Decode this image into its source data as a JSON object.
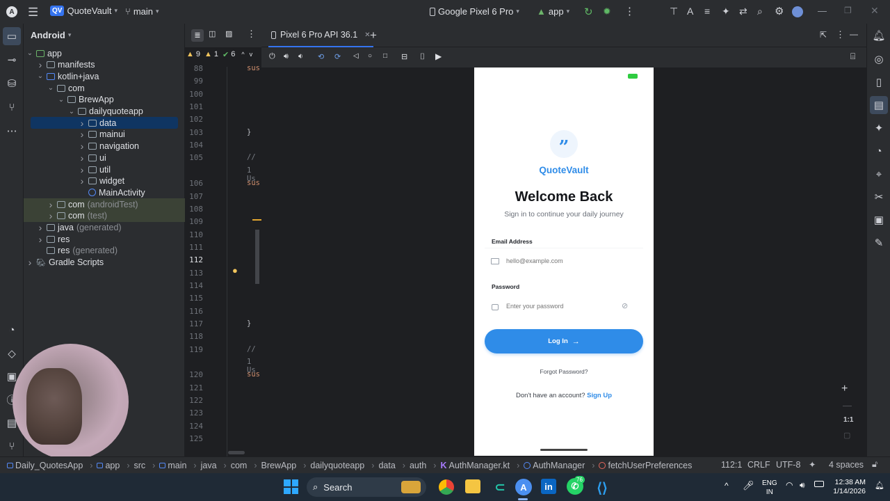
{
  "titlebar": {
    "project_badge": "QV",
    "project_name": "QuoteVault",
    "branch": "main",
    "device": "Google Pixel 6 Pro",
    "run_config": "app"
  },
  "project_panel": {
    "view_mode": "Android",
    "tree": [
      {
        "label": "app",
        "depth": 0,
        "expanded": true,
        "kind": "module"
      },
      {
        "label": "manifests",
        "depth": 1,
        "expanded": false,
        "kind": "folder"
      },
      {
        "label": "kotlin+java",
        "depth": 1,
        "expanded": true,
        "kind": "folder-blue"
      },
      {
        "label": "com",
        "depth": 2,
        "expanded": true,
        "kind": "package"
      },
      {
        "label": "BrewApp",
        "depth": 3,
        "expanded": true,
        "kind": "package"
      },
      {
        "label": "dailyquoteapp",
        "depth": 4,
        "expanded": true,
        "kind": "package"
      },
      {
        "label": "data",
        "depth": 5,
        "expanded": false,
        "kind": "package",
        "selected": true
      },
      {
        "label": "mainui",
        "depth": 5,
        "expanded": false,
        "kind": "package"
      },
      {
        "label": "navigation",
        "depth": 5,
        "expanded": false,
        "kind": "package"
      },
      {
        "label": "ui",
        "depth": 5,
        "expanded": false,
        "kind": "package"
      },
      {
        "label": "util",
        "depth": 5,
        "expanded": false,
        "kind": "package"
      },
      {
        "label": "widget",
        "depth": 5,
        "expanded": false,
        "kind": "package"
      },
      {
        "label": "MainActivity",
        "depth": 5,
        "expanded": null,
        "kind": "class"
      },
      {
        "label": "com",
        "suffix": "(androidTest)",
        "depth": 2,
        "expanded": false,
        "kind": "package",
        "tinted": true
      },
      {
        "label": "com",
        "suffix": "(test)",
        "depth": 2,
        "expanded": false,
        "kind": "package",
        "tinted": true
      },
      {
        "label": "java",
        "suffix": "(generated)",
        "depth": 1,
        "expanded": false,
        "kind": "folder"
      },
      {
        "label": "res",
        "depth": 1,
        "expanded": false,
        "kind": "folder"
      },
      {
        "label": "res",
        "suffix": "(generated)",
        "depth": 1,
        "expanded": null,
        "kind": "folder"
      },
      {
        "label": "Gradle Scripts",
        "depth": 0,
        "expanded": false,
        "kind": "gradle"
      }
    ]
  },
  "editor": {
    "warnings": "9",
    "errors": "1",
    "checks": "6",
    "line_numbers": [
      "88",
      "99",
      "100",
      "101",
      "102",
      "103",
      "104",
      "105",
      "",
      "106",
      "107",
      "108",
      "109",
      "110",
      "111",
      "112",
      "113",
      "114",
      "115",
      "116",
      "117",
      "118",
      "119",
      "",
      "120",
      "121",
      "122",
      "123",
      "124",
      "125"
    ],
    "current_line": "112",
    "fragments": [
      {
        "line_index": 0,
        "text": "sus",
        "color": "#cf8e6d"
      },
      {
        "line_index": 5,
        "text": "}",
        "color": "#bcbec4"
      },
      {
        "line_index": 7,
        "text": "//",
        "color": "#7a7e85"
      },
      {
        "line_index": 8,
        "text": "1 Us",
        "color": "#7a7e85"
      },
      {
        "line_index": 9,
        "text": "sus",
        "color": "#cf8e6d"
      },
      {
        "line_index": 20,
        "text": "}",
        "color": "#bcbec4"
      },
      {
        "line_index": 22,
        "text": "//",
        "color": "#7a7e85"
      },
      {
        "line_index": 23,
        "text": "1 Us",
        "color": "#7a7e85"
      },
      {
        "line_index": 24,
        "text": "sus",
        "color": "#cf8e6d"
      }
    ]
  },
  "emulator": {
    "tab_label": "Pixel 6 Pro API 36.1",
    "zoom_label": "1:1"
  },
  "app_screen": {
    "brand": "QuoteVault",
    "logo_glyph": "”",
    "title": "Welcome Back",
    "subtitle": "Sign in to continue your daily journey",
    "email_label": "Email Address",
    "email_placeholder": "hello@example.com",
    "password_label": "Password",
    "password_placeholder": "Enter your password",
    "login_button": "Log In",
    "forgot_password": "Forgot Password?",
    "no_account": "Don't have an account?",
    "sign_up": "Sign Up",
    "accent_color": "#2f8ce8"
  },
  "breadcrumb": {
    "items": [
      "Daily_QuotesApp",
      "app",
      "src",
      "main",
      "java",
      "com",
      "BrewApp",
      "dailyquoteapp",
      "data",
      "auth",
      "AuthManager.kt",
      "AuthManager",
      "fetchUserPreferences"
    ],
    "position": "112:1",
    "line_sep": "CRLF",
    "encoding": "UTF-8",
    "indent": "4 spaces"
  },
  "taskbar": {
    "search_label": "Search",
    "whatsapp_badge": "76",
    "lang_top": "ENG",
    "lang_bottom": "IN",
    "time": "12:38 AM",
    "date": "1/14/2026"
  }
}
